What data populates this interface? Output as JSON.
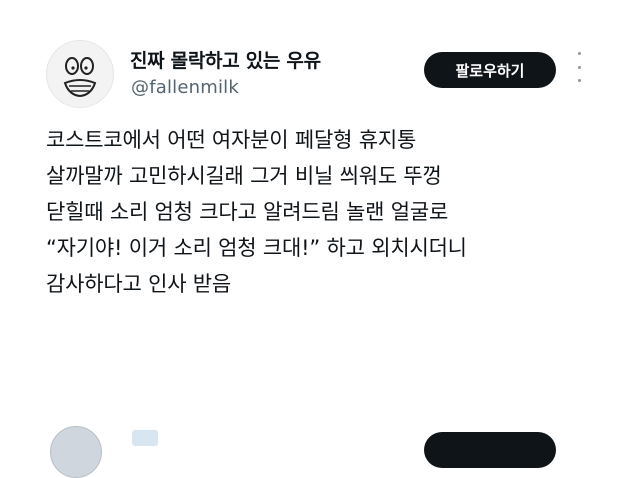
{
  "author": {
    "display_name": "진짜 몰락하고 있는 우유",
    "handle": "@fallenmilk",
    "avatar_icon": "cartoon-face-avatar"
  },
  "follow_label": "팔로우하기",
  "more_icon": "vertical-ellipsis-icon",
  "tweet_lines": [
    "코스트코에서 어떤 여자분이 페달형 휴지통",
    "살까말까 고민하시길래 그거 비닐 씌워도 뚜껑",
    "닫힐때 소리 엄청 크다고 알려드림 놀랜 얼굴로",
    "“자기야! 이거 소리 엄청 크대!” 하고 외치시더니",
    "감사하다고 인사 받음"
  ],
  "colors": {
    "text": "#0f1419",
    "secondary": "#536471",
    "button_bg": "#0f1419",
    "button_text": "#ffffff"
  }
}
